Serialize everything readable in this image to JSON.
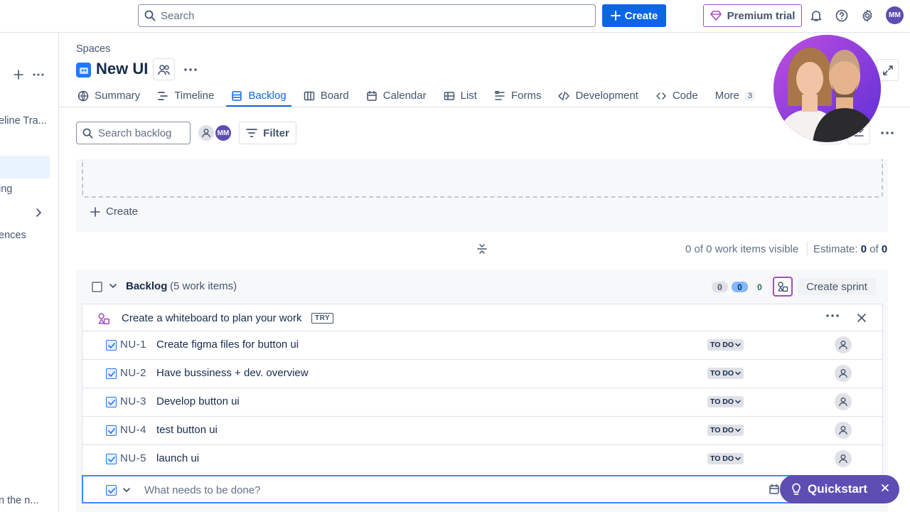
{
  "topbar": {
    "search_placeholder": "Search",
    "create_label": "Create",
    "premium_label": "Premium trial",
    "user_initials": "MM"
  },
  "sidebar": {
    "fragments": [
      "eline Tra...",
      "ing",
      "ences",
      "n the n..."
    ]
  },
  "header": {
    "breadcrumb": "Spaces",
    "project_title": "New UI"
  },
  "tabs": [
    {
      "label": "Summary",
      "icon": "globe-icon"
    },
    {
      "label": "Timeline",
      "icon": "timeline-icon"
    },
    {
      "label": "Backlog",
      "icon": "backlog-icon",
      "active": true
    },
    {
      "label": "Board",
      "icon": "board-icon"
    },
    {
      "label": "Calendar",
      "icon": "calendar-icon"
    },
    {
      "label": "List",
      "icon": "list-icon"
    },
    {
      "label": "Forms",
      "icon": "forms-icon"
    },
    {
      "label": "Development",
      "icon": "code-icon"
    },
    {
      "label": "Code",
      "icon": "code-icon"
    },
    {
      "label": "More",
      "count": "3"
    }
  ],
  "toolbar": {
    "search_placeholder": "Search backlog",
    "avatar_initials": "MM",
    "filter_label": "Filter"
  },
  "sprint": {
    "create_label": "Create",
    "visible_text": "0 of 0 work items visible",
    "estimate_label": "Estimate:",
    "estimate_value": "0",
    "estimate_of": "of",
    "estimate_total": "0"
  },
  "backlog": {
    "title": "Backlog",
    "count_text": "(5 work items)",
    "pill_todo": "0",
    "pill_in_progress": "0",
    "pill_done": "0",
    "create_sprint_label": "Create sprint",
    "whiteboard_prompt": "Create a whiteboard to plan your work",
    "try_badge": "TRY",
    "items": [
      {
        "key": "NU-1",
        "summary": "Create figma files for button ui",
        "status": "TO DO"
      },
      {
        "key": "NU-2",
        "summary": "Have bussiness + dev. overview",
        "status": "TO DO"
      },
      {
        "key": "NU-3",
        "summary": "Develop button ui",
        "status": "TO DO"
      },
      {
        "key": "NU-4",
        "summary": "test button ui",
        "status": "TO DO"
      },
      {
        "key": "NU-5",
        "summary": "launch ui",
        "status": "TO DO"
      }
    ],
    "new_item_placeholder": "What needs to be done?"
  },
  "quickstart": {
    "label": "Quickstart"
  },
  "colors": {
    "primary": "#0c66e4",
    "premium_border": "#a54cc3",
    "avatar_bg": "#5e4db2",
    "quickstart_bg": "#5e4db2"
  }
}
